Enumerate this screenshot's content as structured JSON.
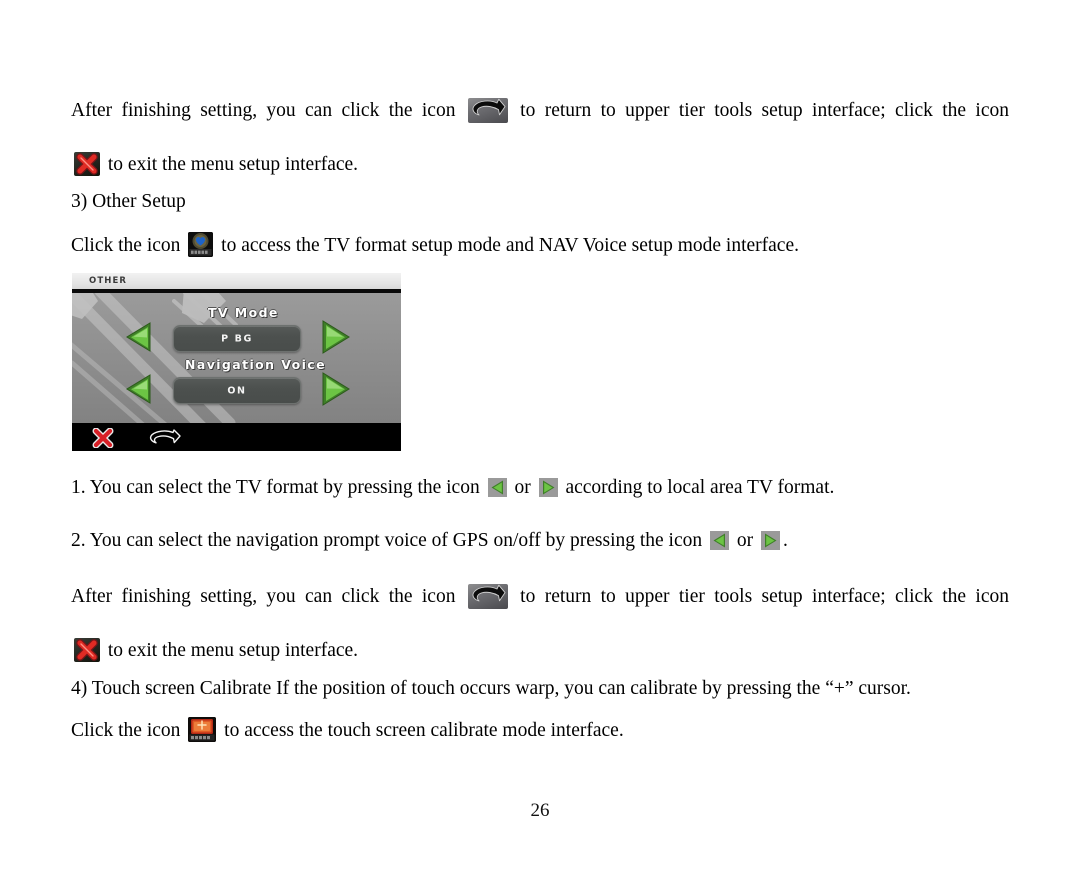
{
  "document": {
    "page_number": "26",
    "paragraphs": {
      "p1_before_icon": "After finishing setting, you can click the icon",
      "p1_mid": "to return to upper tier tools setup interface; click the icon",
      "p1_after": "to exit the menu setup interface.",
      "heading_other_setup": "3) Other Setup",
      "p2_before_icon": "Click the icon",
      "p2_after_icon": "to access the TV format setup mode and NAV Voice setup mode interface.",
      "item1_before": "1. You can select the TV format by pressing the icon",
      "item1_or": "or",
      "item1_after": "according to local area TV format.",
      "item2_before": "2. You can select the navigation prompt voice of GPS on/off by pressing the icon",
      "item2_or": "or",
      "item2_after": ".",
      "p3_before_icon": "After finishing setting, you can click the icon",
      "p3_mid": "to return to upper tier tools setup interface; click the icon",
      "p3_after": "to exit the menu setup interface.",
      "heading_calibrate": "4) Touch screen Calibrate If the position of touch occurs warp, you can calibrate by pressing the “+” cursor.",
      "p4_before_icon": "Click the icon",
      "p4_after_icon": "to access the touch screen calibrate mode interface."
    },
    "icons": {
      "return": "return-arrow-icon",
      "exit": "exit-x-icon",
      "other_setup": "other-setup-icon",
      "calibrate": "touch-calibrate-icon",
      "arrow_left": "green-left-triangle-icon",
      "arrow_right": "green-right-triangle-icon"
    }
  },
  "device_screenshot": {
    "titlebar": {
      "label": "OTHER"
    },
    "settings": [
      {
        "label": "TV Mode",
        "value": "P BG",
        "left_arrow": "green-left-triangle-icon",
        "right_arrow": "green-right-triangle-icon"
      },
      {
        "label": "Navigation Voice",
        "value": "ON",
        "left_arrow": "green-left-triangle-icon",
        "right_arrow": "green-right-triangle-icon"
      }
    ],
    "footer": {
      "exit_icon": "exit-x-icon",
      "back_icon": "back-arrow-icon"
    },
    "colors": {
      "accent_green": "#57a83a",
      "exit_red": "#d81f26",
      "body_grey": "#8f8f8f",
      "value_box": "#4c504e",
      "footer_black": "#000000",
      "titlebar_grey": "#e3e3e3"
    }
  }
}
